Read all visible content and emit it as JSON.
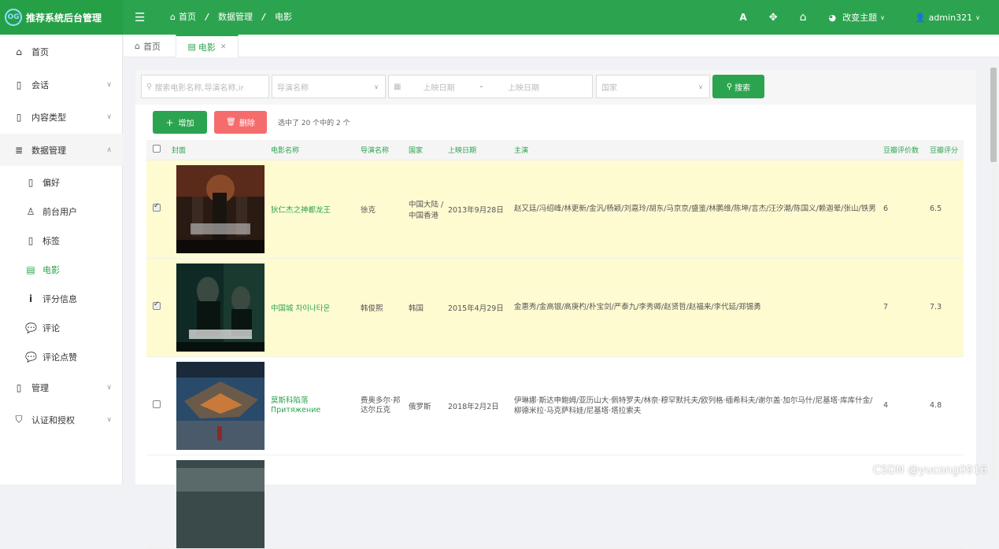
{
  "app": {
    "title": "推荐系统后台管理",
    "logo_mark": "OG"
  },
  "topbar": {
    "breadcrumb": [
      "首页",
      "数据管理",
      "电影"
    ],
    "font_icon": "A",
    "theme_label": "改变主题",
    "user_label": "admin321"
  },
  "sidebar": {
    "items": [
      {
        "label": "首页",
        "icon": "home-icon"
      },
      {
        "label": "会话",
        "icon": "file-icon"
      },
      {
        "label": "内容类型",
        "icon": "file-icon"
      },
      {
        "label": "数据管理",
        "icon": "database-icon"
      },
      {
        "label": "偏好",
        "icon": "file-icon"
      },
      {
        "label": "前台用户",
        "icon": "user-icon"
      },
      {
        "label": "标签",
        "icon": "file-icon"
      },
      {
        "label": "电影",
        "icon": "film-icon"
      },
      {
        "label": "评分信息",
        "icon": "info-icon"
      },
      {
        "label": "评论",
        "icon": "comment-icon"
      },
      {
        "label": "评论点赞",
        "icon": "comment-icon"
      },
      {
        "label": "管理",
        "icon": "file-icon"
      },
      {
        "label": "认证和授权",
        "icon": "shield-icon"
      }
    ]
  },
  "tabs": [
    {
      "label": "首页"
    },
    {
      "label": "电影"
    }
  ],
  "search": {
    "keyword_placeholder": "搜索电影名称,导演名称,ir",
    "director_placeholder": "导演名称",
    "date_start_placeholder": "上映日期",
    "date_sep": "-",
    "date_end_placeholder": "上映日期",
    "country_placeholder": "国家",
    "search_label": "搜索"
  },
  "toolbar": {
    "add_label": "增加",
    "delete_label": "删除",
    "selection_hint": "选中了 20 个中的 2 个"
  },
  "table": {
    "headers": [
      "封面",
      "电影名称",
      "导演名称",
      "国家",
      "上映日期",
      "主演",
      "豆瓣评价数",
      "豆瓣评分"
    ],
    "rows": [
      {
        "checked": true,
        "name": "狄仁杰之神都龙王",
        "director": "徐克",
        "country": "中国大陆 / 中国香港",
        "date": "2013年9月28日",
        "actors": "赵又廷/冯绍峰/林更新/金汎/杨颖/刘嘉玲/胡东/马京京/盛鉴/林鹏维/陈坤/言杰/汪汐潮/陈国义/赖迦晕/张山/铁男",
        "votes": "6",
        "score": "6.5"
      },
      {
        "checked": true,
        "name": "中国城 차이나타운",
        "director": "韩俊熙",
        "country": "韩国",
        "date": "2015年4月29日",
        "actors": "金惠秀/金高银/高庚杓/朴宝剑/严泰九/李秀卿/赵贤哲/赵福来/李代延/郑锡勇",
        "votes": "7",
        "score": "7.3"
      },
      {
        "checked": false,
        "name": "莫斯科陷落 Притяжение",
        "director": "费奥多尔·邦达尔丘克",
        "country": "俄罗斯",
        "date": "2018年2月2日",
        "actors": "伊琳娜·斯达申鲍姆/亚历山大·佩特罗夫/林奈·穆罕默托夫/欧列格·缅希科夫/谢尔盖·加尔马什/尼基塔·库库什金/柳德米拉·马克萨科娃/尼基塔·塔拉索夫",
        "votes": "4",
        "score": "4.8"
      }
    ]
  },
  "watermark": "CSDN @yucong0916",
  "colors": {
    "accent": "#2ca44f",
    "danger": "#f56c6c",
    "selected_row": "#fffbd1"
  }
}
